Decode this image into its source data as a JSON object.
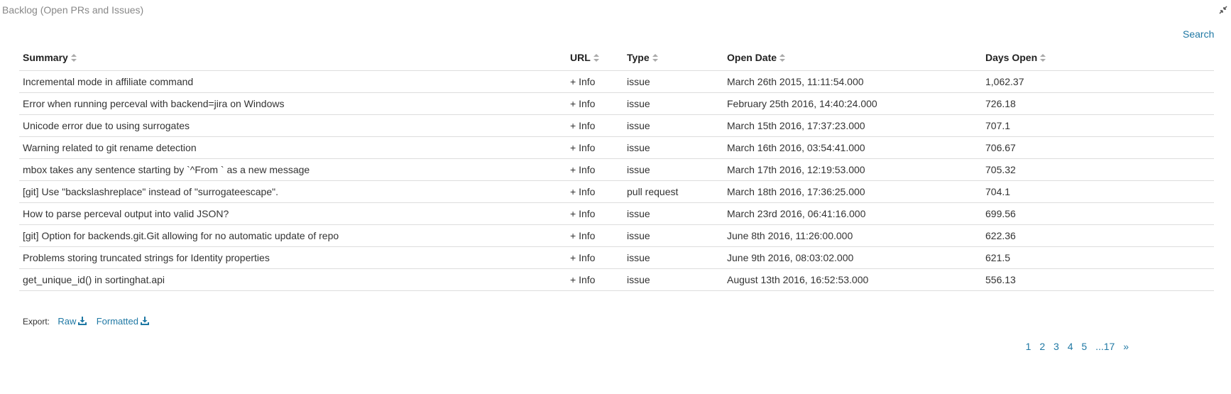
{
  "panel": {
    "title": "Backlog (Open PRs and Issues)",
    "search_label": "Search"
  },
  "table": {
    "headers": [
      "Summary",
      "URL",
      "Type",
      "Open Date",
      "Days Open"
    ],
    "rows": [
      [
        "Incremental mode in affiliate command",
        "+ Info",
        "issue",
        "March 26th 2015, 11:11:54.000",
        "1,062.37"
      ],
      [
        "Error when running perceval with backend=jira on Windows",
        "+ Info",
        "issue",
        "February 25th 2016, 14:40:24.000",
        "726.18"
      ],
      [
        "Unicode error due to using surrogates",
        "+ Info",
        "issue",
        "March 15th 2016, 17:37:23.000",
        "707.1"
      ],
      [
        "Warning related to git rename detection",
        "+ Info",
        "issue",
        "March 16th 2016, 03:54:41.000",
        "706.67"
      ],
      [
        "mbox takes any sentence starting by `^From ` as a new message",
        "+ Info",
        "issue",
        "March 17th 2016, 12:19:53.000",
        "705.32"
      ],
      [
        "[git] Use \"backslashreplace\" instead of \"surrogateescape\".",
        "+ Info",
        "pull request",
        "March 18th 2016, 17:36:25.000",
        "704.1"
      ],
      [
        "How to parse perceval output into valid JSON?",
        "+ Info",
        "issue",
        "March 23rd 2016, 06:41:16.000",
        "699.56"
      ],
      [
        "[git] Option for backends.git.Git allowing for no automatic update of repo",
        "+ Info",
        "issue",
        "June 8th 2016, 11:26:00.000",
        "622.36"
      ],
      [
        "Problems storing truncated strings for Identity properties",
        "+ Info",
        "issue",
        "June 9th 2016, 08:03:02.000",
        "621.5"
      ],
      [
        "get_unique_id() in sortinghat.api",
        "+ Info",
        "issue",
        "August 13th 2016, 16:52:53.000",
        "556.13"
      ]
    ]
  },
  "export": {
    "label": "Export:",
    "raw_label": "Raw",
    "formatted_label": "Formatted"
  },
  "pagination": [
    "1",
    "2",
    "3",
    "4",
    "5",
    "...17",
    "»"
  ],
  "colors": {
    "link": "#1f78a4",
    "text": "#333333",
    "muted": "#888888",
    "border": "#dddddd"
  },
  "icons": {
    "collapse": "compress-icon",
    "sort": "sort-icon",
    "download": "download-icon"
  }
}
